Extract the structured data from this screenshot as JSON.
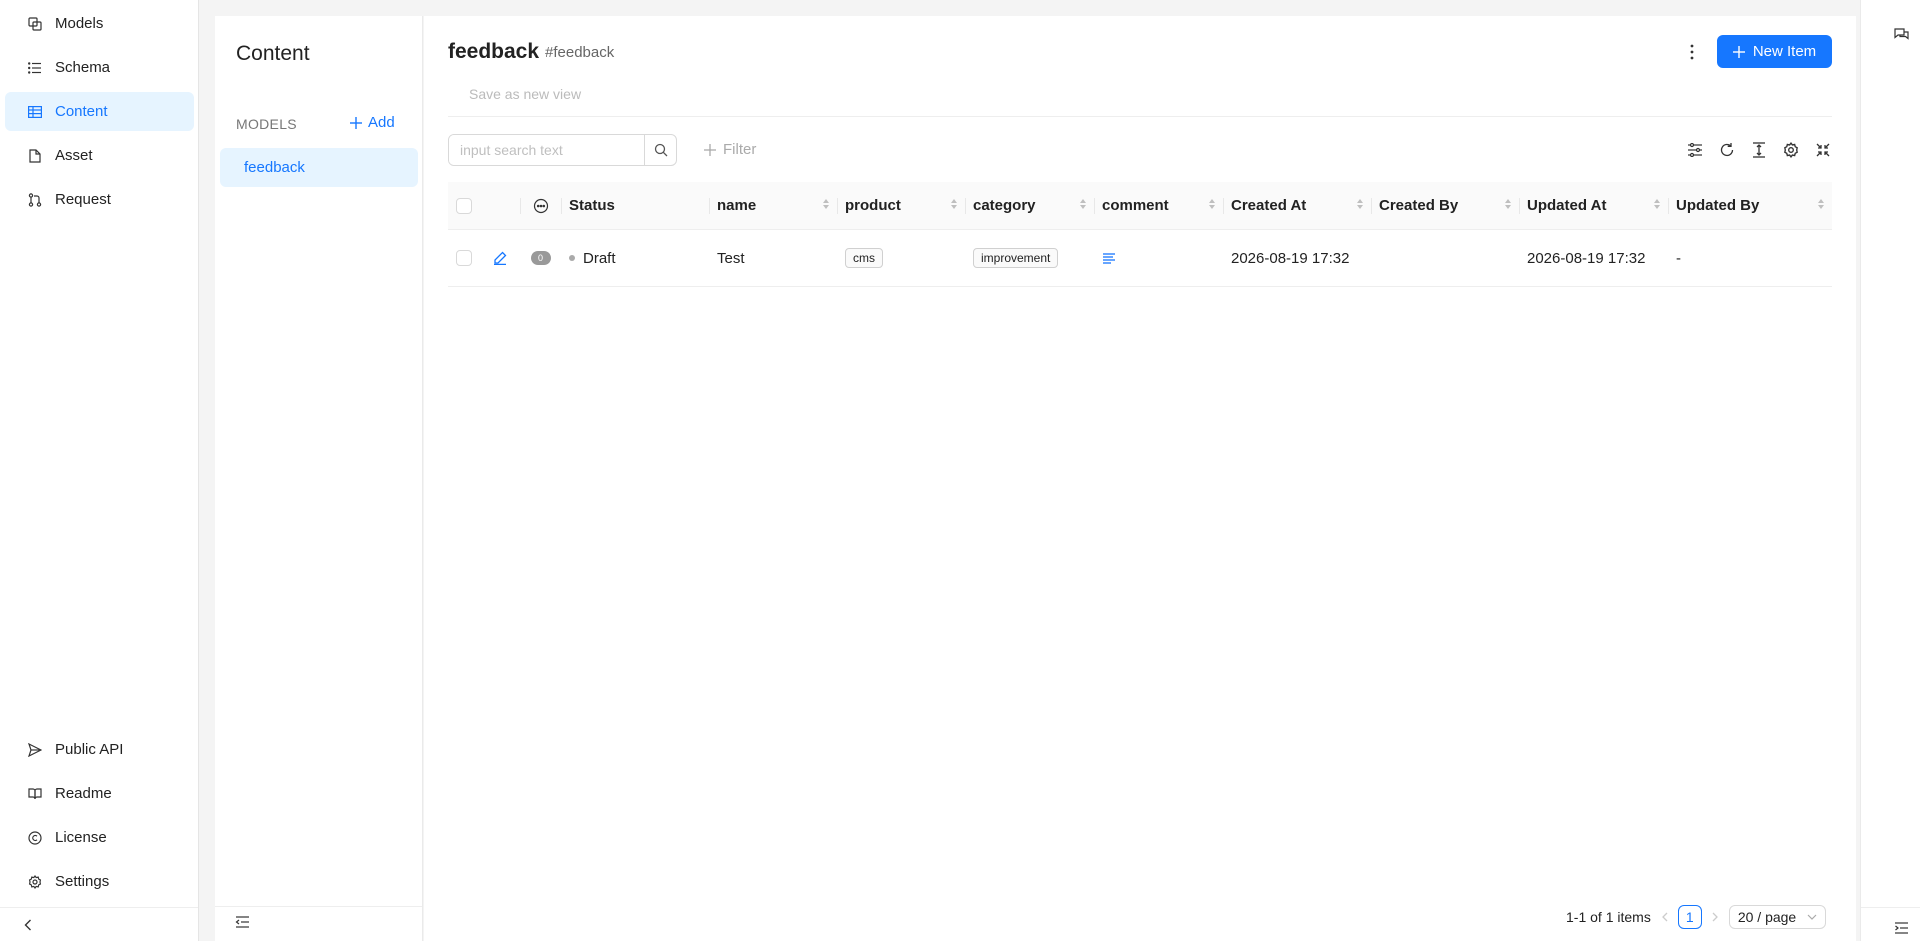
{
  "nav": {
    "items": [
      {
        "label": "Models",
        "icon": "models-icon"
      },
      {
        "label": "Schema",
        "icon": "schema-icon"
      },
      {
        "label": "Content",
        "icon": "content-table-icon",
        "active": true
      },
      {
        "label": "Asset",
        "icon": "file-icon"
      },
      {
        "label": "Request",
        "icon": "pull-request-icon"
      }
    ],
    "bottom_items": [
      {
        "label": "Public API",
        "icon": "send-icon"
      },
      {
        "label": "Readme",
        "icon": "book-icon"
      },
      {
        "label": "License",
        "icon": "copyright-icon"
      },
      {
        "label": "Settings",
        "icon": "gear-icon"
      }
    ]
  },
  "model_panel": {
    "title": "Content",
    "models_label": "MODELS",
    "add_label": "Add",
    "models": [
      "feedback"
    ]
  },
  "header": {
    "title": "feedback",
    "key": "#feedback",
    "new_item_label": "New Item",
    "save_view_label": "Save as new view"
  },
  "toolbar": {
    "search_placeholder": "input search text",
    "filter_label": "Filter"
  },
  "table": {
    "columns": [
      "Status",
      "name",
      "product",
      "category",
      "comment",
      "Created At",
      "Created By",
      "Updated At",
      "Updated By"
    ],
    "rows": [
      {
        "comment_count": "0",
        "status": "Draft",
        "name": "Test",
        "product": "cms",
        "category": "improvement",
        "created_at": "2026-08-19 17:32",
        "created_by": "",
        "updated_at": "2026-08-19 17:32",
        "updated_by": "-"
      }
    ]
  },
  "pagination": {
    "summary": "1-1 of 1 items",
    "current_page": "1",
    "page_size": "20 / page"
  },
  "colors": {
    "accent": "#1677ff",
    "active_bg": "#e6f4ff"
  }
}
